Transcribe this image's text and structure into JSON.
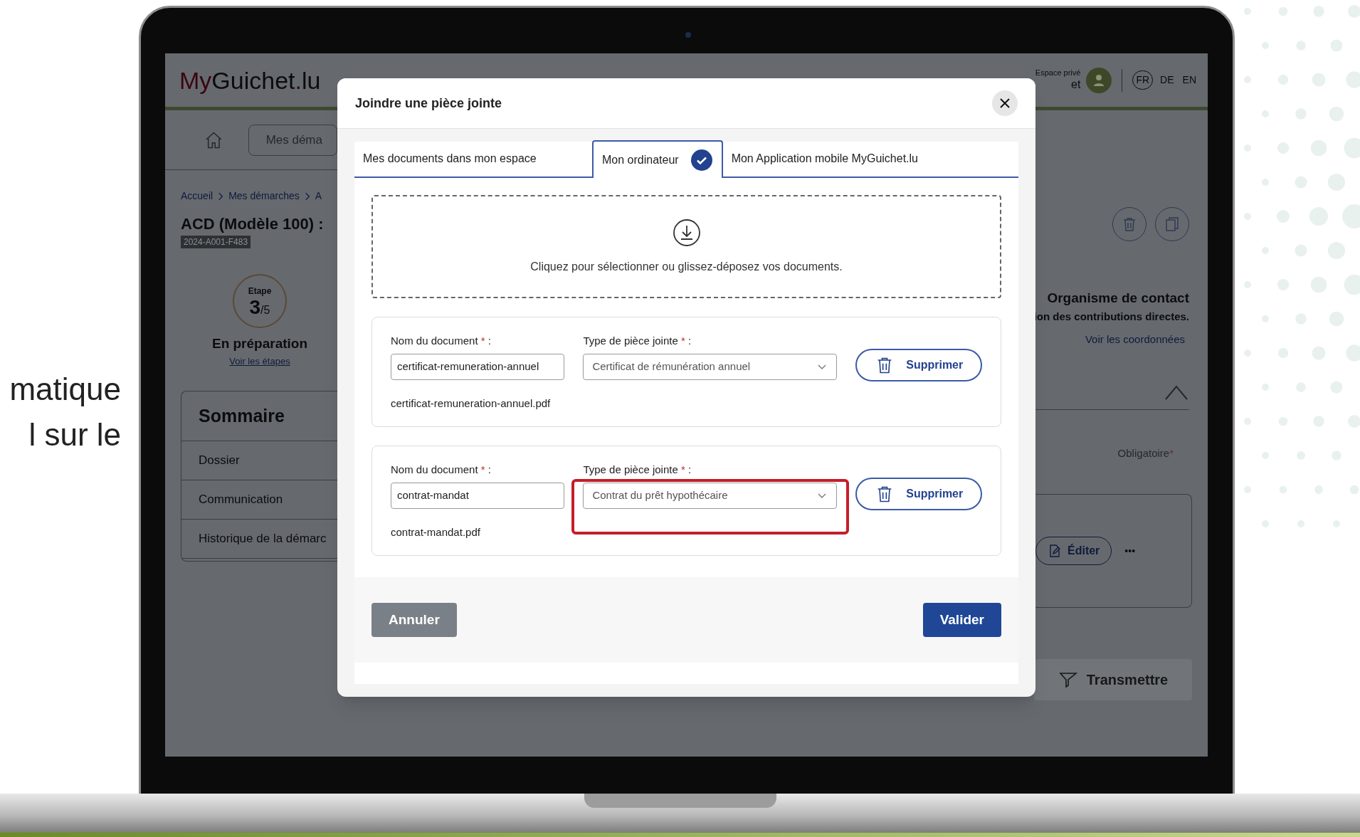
{
  "slide_text": [
    "matique",
    "l sur le"
  ],
  "page": {
    "logo": [
      {
        "text": "My",
        "color": "#3a0610"
      },
      {
        "text": "Guichet",
        "color": "#0b0c0e"
      },
      {
        "text": ".",
        "color": "#3a0610"
      },
      {
        "text": "lu",
        "color": "#0b0c0e"
      }
    ],
    "account": {
      "label": "Espace privé",
      "name": "et"
    },
    "languages": [
      {
        "code": "FR",
        "selected": true
      },
      {
        "code": "DE",
        "selected": false
      },
      {
        "code": "EN",
        "selected": false
      }
    ],
    "nav_button": "Mes déma",
    "breadcrumb": [
      "Accueil",
      "Mes démarches",
      "A"
    ],
    "title": "ACD (Modèle 100) :",
    "reference": "2024-A001-F483",
    "step": {
      "label": "Etape",
      "current": "3",
      "total": "/5",
      "status": "En préparation",
      "link": "Voir les étapes"
    },
    "summary": {
      "title": "Sommaire",
      "items": [
        "Dossier",
        "Communication",
        "Historique de la démarc"
      ]
    },
    "contact": {
      "title": "Organisme de contact",
      "name": "ion des contributions directes.",
      "link": "Voir les coordonnées"
    },
    "required_note": {
      "text": "Obligatoire",
      "mark": "*"
    },
    "edit_button": "Éditer",
    "more_button": "•••",
    "submit_button": "Transmettre"
  },
  "dialog": {
    "title": "Joindre une pièce jointe",
    "tabs": [
      {
        "label": "Mes documents dans mon espace",
        "selected": false
      },
      {
        "label": "Mon ordinateur",
        "selected": true
      },
      {
        "label": "Mon Application mobile MyGuichet.lu",
        "selected": false
      }
    ],
    "dropzone": "Cliquez pour sélectionner ou glissez-déposez vos documents.",
    "documents": [
      {
        "name_label": "Nom du document",
        "type_label": "Type de pièce jointe",
        "required_mark": "*",
        "colon": ":",
        "name_value": "certificat-remuneration-annuel",
        "type_value": "Certificat de rémunération annuel",
        "delete_button": "Supprimer",
        "file_name": "certificat-remuneration-annuel.pdf",
        "highlighted": false
      },
      {
        "name_label": "Nom du document",
        "type_label": "Type de pièce jointe",
        "required_mark": "*",
        "colon": ":",
        "name_value": "contrat-mandat",
        "type_value": "Contrat du prêt hypothécaire",
        "delete_button": "Supprimer",
        "file_name": "contrat-mandat.pdf",
        "highlighted": true
      }
    ],
    "cancel_button": "Annuler",
    "confirm_button": "Valider"
  }
}
